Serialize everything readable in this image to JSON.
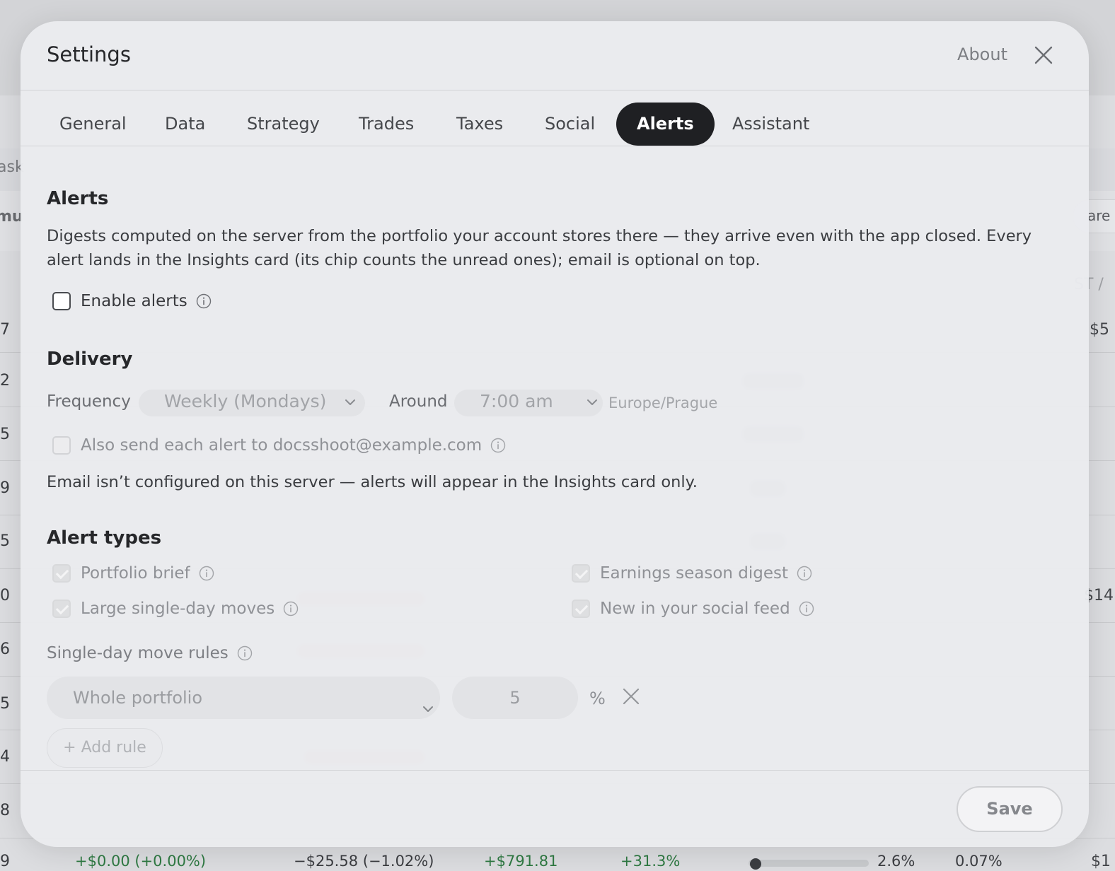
{
  "background": {
    "edge_texts": [
      "ask",
      "mu",
      "are",
      "ST /",
      "$5",
      "$14",
      "$1"
    ],
    "row_numbers": [
      "7",
      "2",
      "5",
      "9",
      "5",
      "0",
      "6",
      "5",
      "4",
      "8",
      "9"
    ],
    "bottom_row": {
      "change": "+$0.00 (+0.00%)",
      "loss": "−$25.58 (−1.02%)",
      "gain": "+$791.81",
      "gain_pct": "+31.3%",
      "weight": "2.6%",
      "small": "0.07%"
    }
  },
  "modal": {
    "title": "Settings",
    "about_label": "About",
    "tabs": [
      "General",
      "Data",
      "Strategy",
      "Trades",
      "Taxes",
      "Social",
      "Alerts",
      "Assistant"
    ],
    "active_tab": "Alerts"
  },
  "alerts": {
    "heading": "Alerts",
    "description": "Digests computed on the server from the portfolio your account stores there — they arrive even with the app closed. Every alert lands in the Insights card (its chip counts the unread ones); email is optional on top.",
    "enable_label": "Enable alerts",
    "enable_checked": false
  },
  "delivery": {
    "heading": "Delivery",
    "frequency_label": "Frequency",
    "frequency_value": "Weekly (Mondays)",
    "around_label": "Around",
    "time_value": "7:00 am",
    "timezone": "Europe/Prague",
    "email_label": "Also send each alert to docsshoot@example.com",
    "email_note": "Email isn’t configured on this server — alerts will appear in the Insights card only."
  },
  "alert_types": {
    "heading": "Alert types",
    "items": [
      {
        "label": "Portfolio brief",
        "checked": true
      },
      {
        "label": "Earnings season digest",
        "checked": true
      },
      {
        "label": "Large single-day moves",
        "checked": true
      },
      {
        "label": "New in your social feed",
        "checked": true
      }
    ]
  },
  "rules": {
    "heading": "Single-day move rules",
    "scope_value": "Whole portfolio",
    "threshold_value": "5",
    "unit": "%",
    "add_label": "+ Add rule"
  },
  "footer": {
    "save_label": "Save"
  },
  "icons": {
    "close": "close-icon",
    "info": "info-icon",
    "chevron": "chevron-down-icon"
  }
}
